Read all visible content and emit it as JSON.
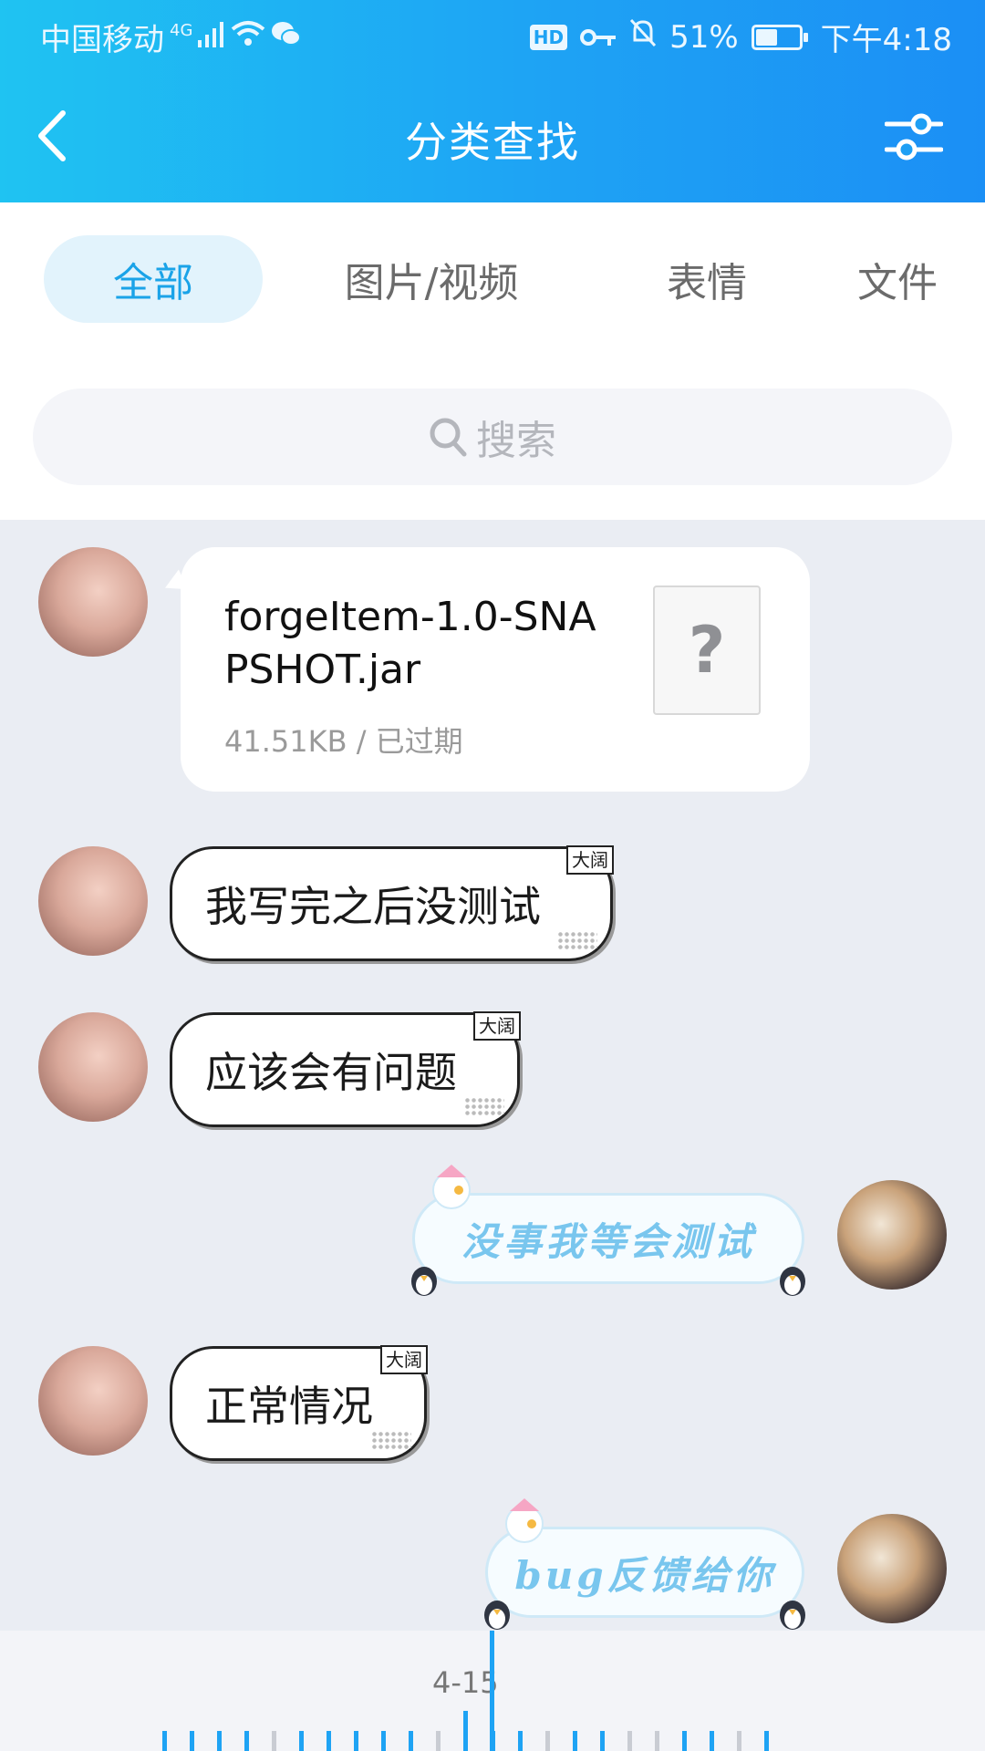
{
  "status": {
    "carrier": "中国移动",
    "network": "4G",
    "battery": "51%",
    "battery_level": 0.51,
    "time": "下午4:18",
    "hd": "HD"
  },
  "header": {
    "title": "分类查找",
    "back_icon": "back-arrow-icon",
    "filter_icon": "filter-sliders-icon"
  },
  "tabs": [
    {
      "label": "全部",
      "active": true
    },
    {
      "label": "图片/视频",
      "active": false
    },
    {
      "label": "表情",
      "active": false
    },
    {
      "label": "文件",
      "active": false
    }
  ],
  "search": {
    "placeholder": "搜索"
  },
  "messages": [
    {
      "type": "file",
      "side": "left",
      "file_name": "forgeItem-1.0-SNAPSHOT.jar",
      "meta": "41.51KB / 已过期",
      "icon": "?"
    },
    {
      "type": "text",
      "side": "left",
      "text": "我写完之后没测试",
      "tag": "大阔"
    },
    {
      "type": "text",
      "side": "left",
      "text": "应该会有问题",
      "tag": "大阔"
    },
    {
      "type": "text",
      "side": "right",
      "text": "没事我等会测试"
    },
    {
      "type": "text",
      "side": "left",
      "text": "正常情况",
      "tag": "大阔"
    },
    {
      "type": "text",
      "side": "right",
      "text": "bug反馈给你"
    }
  ],
  "timeline": {
    "date_label": "4-15"
  },
  "colors": {
    "accent": "#1ea3f4",
    "active_tab_bg": "#e2f3fc",
    "chat_bg": "#eaedf3"
  }
}
